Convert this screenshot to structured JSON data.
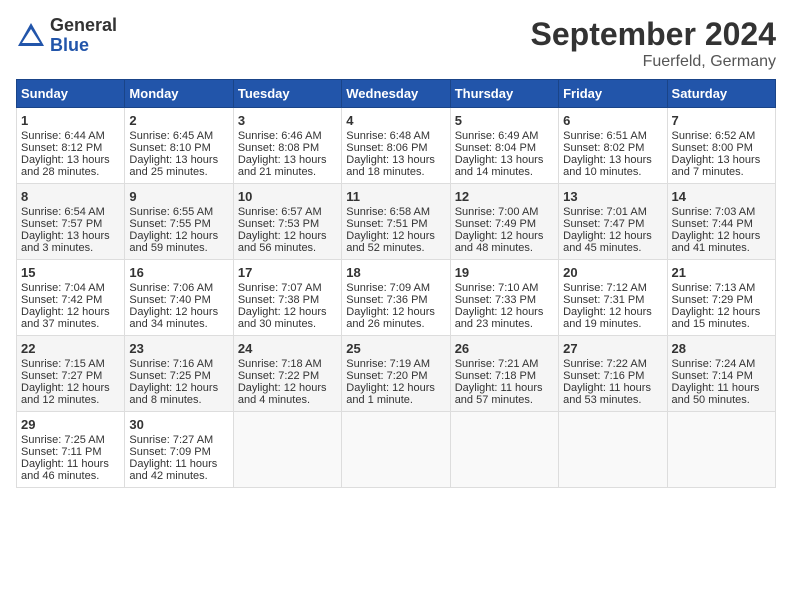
{
  "header": {
    "logo_general": "General",
    "logo_blue": "Blue",
    "title": "September 2024",
    "subtitle": "Fuerfeld, Germany"
  },
  "days_of_week": [
    "Sunday",
    "Monday",
    "Tuesday",
    "Wednesday",
    "Thursday",
    "Friday",
    "Saturday"
  ],
  "weeks": [
    [
      {
        "day": "1",
        "sunrise": "6:44 AM",
        "sunset": "8:12 PM",
        "daylight": "13 hours and 28 minutes."
      },
      {
        "day": "2",
        "sunrise": "6:45 AM",
        "sunset": "8:10 PM",
        "daylight": "13 hours and 25 minutes."
      },
      {
        "day": "3",
        "sunrise": "6:46 AM",
        "sunset": "8:08 PM",
        "daylight": "13 hours and 21 minutes."
      },
      {
        "day": "4",
        "sunrise": "6:48 AM",
        "sunset": "8:06 PM",
        "daylight": "13 hours and 18 minutes."
      },
      {
        "day": "5",
        "sunrise": "6:49 AM",
        "sunset": "8:04 PM",
        "daylight": "13 hours and 14 minutes."
      },
      {
        "day": "6",
        "sunrise": "6:51 AM",
        "sunset": "8:02 PM",
        "daylight": "13 hours and 10 minutes."
      },
      {
        "day": "7",
        "sunrise": "6:52 AM",
        "sunset": "8:00 PM",
        "daylight": "13 hours and 7 minutes."
      }
    ],
    [
      {
        "day": "8",
        "sunrise": "6:54 AM",
        "sunset": "7:57 PM",
        "daylight": "13 hours and 3 minutes."
      },
      {
        "day": "9",
        "sunrise": "6:55 AM",
        "sunset": "7:55 PM",
        "daylight": "12 hours and 59 minutes."
      },
      {
        "day": "10",
        "sunrise": "6:57 AM",
        "sunset": "7:53 PM",
        "daylight": "12 hours and 56 minutes."
      },
      {
        "day": "11",
        "sunrise": "6:58 AM",
        "sunset": "7:51 PM",
        "daylight": "12 hours and 52 minutes."
      },
      {
        "day": "12",
        "sunrise": "7:00 AM",
        "sunset": "7:49 PM",
        "daylight": "12 hours and 48 minutes."
      },
      {
        "day": "13",
        "sunrise": "7:01 AM",
        "sunset": "7:47 PM",
        "daylight": "12 hours and 45 minutes."
      },
      {
        "day": "14",
        "sunrise": "7:03 AM",
        "sunset": "7:44 PM",
        "daylight": "12 hours and 41 minutes."
      }
    ],
    [
      {
        "day": "15",
        "sunrise": "7:04 AM",
        "sunset": "7:42 PM",
        "daylight": "12 hours and 37 minutes."
      },
      {
        "day": "16",
        "sunrise": "7:06 AM",
        "sunset": "7:40 PM",
        "daylight": "12 hours and 34 minutes."
      },
      {
        "day": "17",
        "sunrise": "7:07 AM",
        "sunset": "7:38 PM",
        "daylight": "12 hours and 30 minutes."
      },
      {
        "day": "18",
        "sunrise": "7:09 AM",
        "sunset": "7:36 PM",
        "daylight": "12 hours and 26 minutes."
      },
      {
        "day": "19",
        "sunrise": "7:10 AM",
        "sunset": "7:33 PM",
        "daylight": "12 hours and 23 minutes."
      },
      {
        "day": "20",
        "sunrise": "7:12 AM",
        "sunset": "7:31 PM",
        "daylight": "12 hours and 19 minutes."
      },
      {
        "day": "21",
        "sunrise": "7:13 AM",
        "sunset": "7:29 PM",
        "daylight": "12 hours and 15 minutes."
      }
    ],
    [
      {
        "day": "22",
        "sunrise": "7:15 AM",
        "sunset": "7:27 PM",
        "daylight": "12 hours and 12 minutes."
      },
      {
        "day": "23",
        "sunrise": "7:16 AM",
        "sunset": "7:25 PM",
        "daylight": "12 hours and 8 minutes."
      },
      {
        "day": "24",
        "sunrise": "7:18 AM",
        "sunset": "7:22 PM",
        "daylight": "12 hours and 4 minutes."
      },
      {
        "day": "25",
        "sunrise": "7:19 AM",
        "sunset": "7:20 PM",
        "daylight": "12 hours and 1 minute."
      },
      {
        "day": "26",
        "sunrise": "7:21 AM",
        "sunset": "7:18 PM",
        "daylight": "11 hours and 57 minutes."
      },
      {
        "day": "27",
        "sunrise": "7:22 AM",
        "sunset": "7:16 PM",
        "daylight": "11 hours and 53 minutes."
      },
      {
        "day": "28",
        "sunrise": "7:24 AM",
        "sunset": "7:14 PM",
        "daylight": "11 hours and 50 minutes."
      }
    ],
    [
      {
        "day": "29",
        "sunrise": "7:25 AM",
        "sunset": "7:11 PM",
        "daylight": "11 hours and 46 minutes."
      },
      {
        "day": "30",
        "sunrise": "7:27 AM",
        "sunset": "7:09 PM",
        "daylight": "11 hours and 42 minutes."
      },
      null,
      null,
      null,
      null,
      null
    ]
  ]
}
